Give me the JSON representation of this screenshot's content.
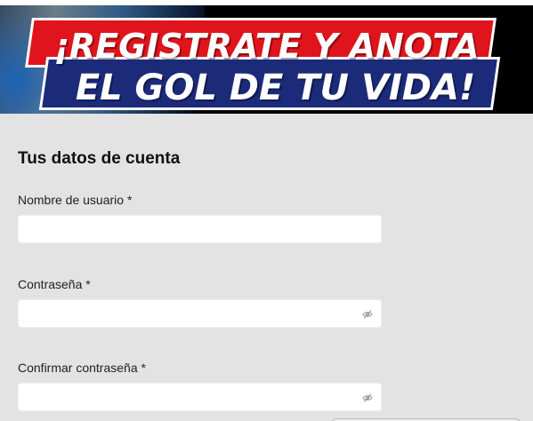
{
  "banner": {
    "line1": "¡REGISTRATE Y ANOTA",
    "line2": "EL GOL DE TU VIDA!"
  },
  "form": {
    "title": "Tus datos de cuenta",
    "fields": [
      {
        "label": "Nombre de usuario *",
        "value": "",
        "type": "text"
      },
      {
        "label": "Contraseña *",
        "value": "",
        "type": "password",
        "icon": "eye-off-icon"
      },
      {
        "label": "Confirmar contraseña *",
        "value": "",
        "type": "password",
        "icon": "eye-off-icon"
      }
    ]
  },
  "colors": {
    "banner_red": "#e0141c",
    "banner_blue": "#1c2a7a",
    "form_background": "#e3e3e3",
    "input_background": "#ffffff"
  }
}
